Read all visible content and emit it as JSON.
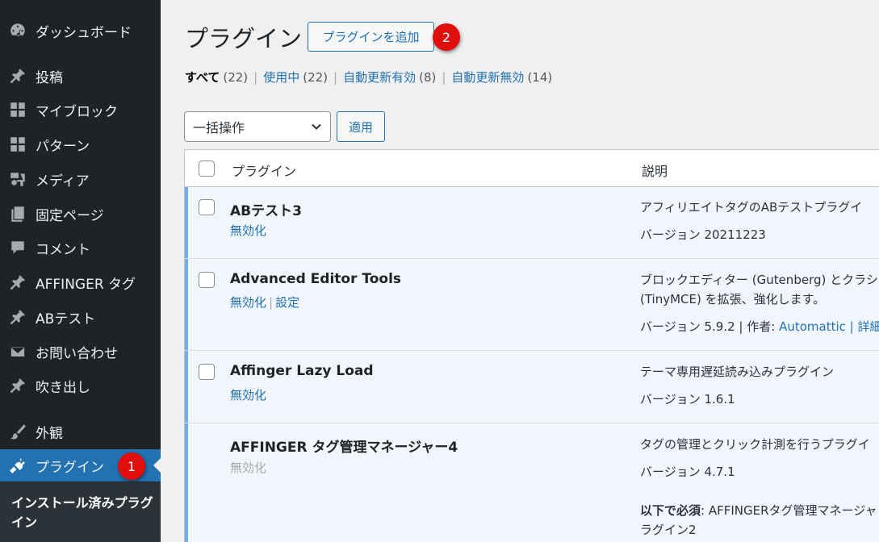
{
  "sidebar": {
    "items": [
      {
        "label": "ダッシュボード",
        "icon": "dashboard-icon"
      },
      {
        "label": "投稿",
        "icon": "pin-icon"
      },
      {
        "label": "マイブロック",
        "icon": "grid-icon"
      },
      {
        "label": "パターン",
        "icon": "grid-icon"
      },
      {
        "label": "メディア",
        "icon": "media-icon"
      },
      {
        "label": "固定ページ",
        "icon": "pages-icon"
      },
      {
        "label": "コメント",
        "icon": "comment-icon"
      },
      {
        "label": "AFFINGER タグ",
        "icon": "pin-icon"
      },
      {
        "label": "ABテスト",
        "icon": "pin-icon"
      },
      {
        "label": "お問い合わせ",
        "icon": "mail-icon"
      },
      {
        "label": "吹き出し",
        "icon": "pin-icon"
      },
      {
        "label": "外観",
        "icon": "brush-icon"
      },
      {
        "label": "プラグイン",
        "icon": "plugin-icon"
      }
    ],
    "submenu_label": "インストール済みプラグイン",
    "badge_1": "1"
  },
  "header": {
    "title": "プラグイン",
    "add_button": "プラグインを追加",
    "badge_2": "2"
  },
  "filters": {
    "all_label": "すべて",
    "all_count": "(22)",
    "active_label": "使用中",
    "active_count": "(22)",
    "auto_on_label": "自動更新有効",
    "auto_on_count": "(8)",
    "auto_off_label": "自動更新無効",
    "auto_off_count": "(14)"
  },
  "bulk": {
    "select_value": "一括操作",
    "apply_label": "適用"
  },
  "table": {
    "col_plugin": "プラグイン",
    "col_desc": "説明",
    "rows": [
      {
        "name": "ABテスト3",
        "action1": "無効化",
        "desc1": "アフィリエイトタグのABテストプラグイ",
        "version": "バージョン 20211223"
      },
      {
        "name": "Advanced Editor Tools",
        "action1": "無効化",
        "action2": "設定",
        "desc1": "ブロックエディター (Gutenberg) とクラシ",
        "desc2": "(TinyMCE) を拡張、強化します。",
        "version": "バージョン 5.9.2 | 作者: ",
        "author": "Automattic",
        "details": " | 詳細"
      },
      {
        "name": "Affinger Lazy Load",
        "action1": "無効化",
        "desc1": "テーマ専用遅延読み込みプラグイン",
        "version": "バージョン 1.6.1"
      },
      {
        "name": "AFFINGER タグ管理マネージャー4",
        "action1": "無効化",
        "desc1": "タグの管理とクリック計測を行うプラグイ",
        "version": "バージョン 4.7.1",
        "req_label": "以下で必須",
        "req_text": ": AFFINGERタグ管理マネージャ",
        "req_text2": "ラグイン2"
      }
    ]
  },
  "colors": {
    "sidebar_bg": "#1d2327",
    "accent": "#2271b1",
    "badge": "#e10e0e",
    "active_row_bg": "#f0f6fc",
    "active_row_border": "#72aee6"
  }
}
